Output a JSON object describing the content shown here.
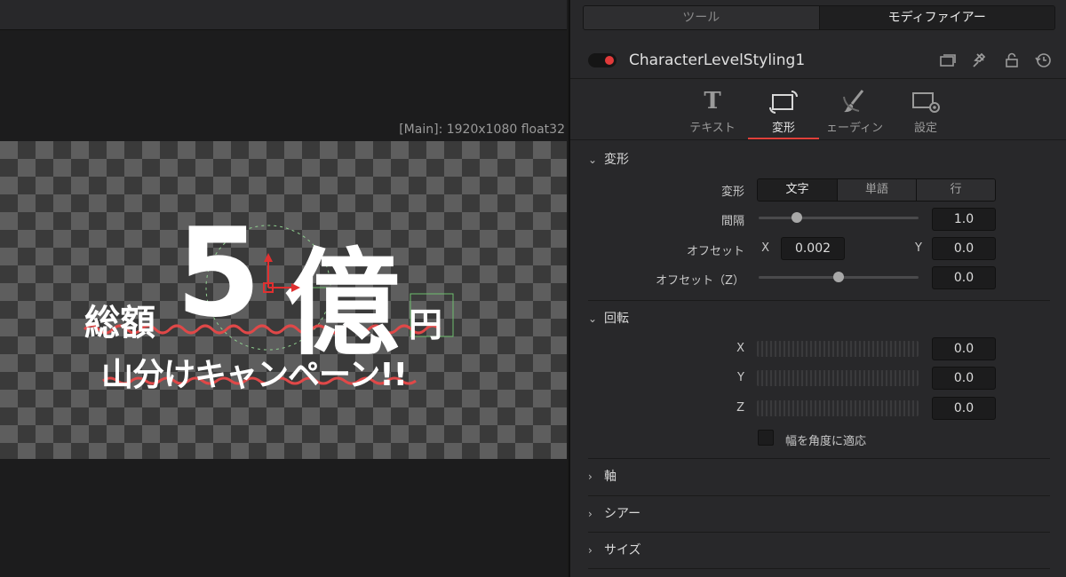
{
  "viewer": {
    "resolution": "[Main]: 1920x1080 float32",
    "title_line1": {
      "prefix": "総額",
      "number": "5",
      "unit_big": "億",
      "suffix": "円"
    },
    "title_line2": "山分けキャンペーン!!"
  },
  "inspector": {
    "top_tabs": [
      "ツール",
      "モディファイアー"
    ],
    "active_top_tab": "モディファイアー",
    "node_name": "CharacterLevelStyling1",
    "subtabs": [
      {
        "label": "テキスト",
        "icon": "text-t-icon"
      },
      {
        "label": "変形",
        "icon": "transform-icon"
      },
      {
        "label": "ェーディン",
        "icon": "shading-brush-icon"
      },
      {
        "label": "設定",
        "icon": "settings-gear-icon"
      }
    ],
    "active_subtab": "変形",
    "transform": {
      "title": "変形",
      "mode_label": "変形",
      "mode_options": [
        "文字",
        "単語",
        "行"
      ],
      "mode_selected": "文字",
      "spacing_label": "間隔",
      "spacing_value": "1.0",
      "spacing_level": 0.24,
      "offset_label": "オフセット",
      "offset_x_label": "X",
      "offset_x_value": "0.002",
      "offset_y_label": "Y",
      "offset_y_value": "0.0",
      "offset_z_label": "オフセット（Z）",
      "offset_z_value": "0.0",
      "offset_z_level": 0.5
    },
    "rotation": {
      "title": "回転",
      "x_label": "X",
      "x_value": "0.0",
      "y_label": "Y",
      "y_value": "0.0",
      "z_label": "Z",
      "z_value": "0.0",
      "fit_label": "幅を角度に適応"
    },
    "collapsed_sections": [
      "軸",
      "シアー",
      "サイズ"
    ]
  }
}
